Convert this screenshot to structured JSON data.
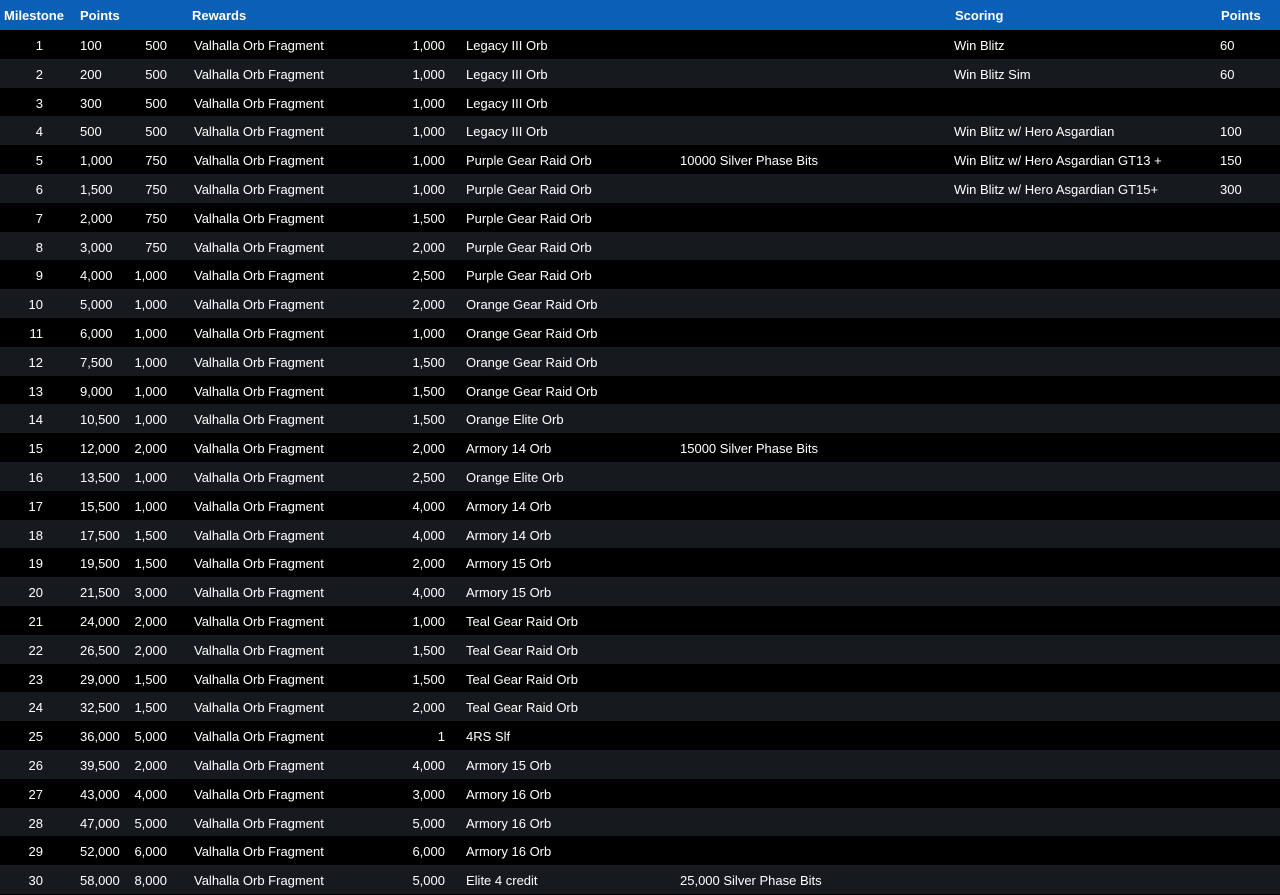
{
  "headers": {
    "milestone": "Milestone",
    "points": "Points",
    "rewards": "Rewards",
    "scoring": "Scoring",
    "scoring_points": "Points"
  },
  "rows": [
    {
      "milestone": "1",
      "points": "100",
      "r1_qty": "500",
      "r1_name": "Valhalla Orb Fragment",
      "r2_qty": "1,000",
      "r2_name": "Legacy III Orb",
      "r3": "",
      "scoring": "Win Blitz",
      "scoring_points": "60"
    },
    {
      "milestone": "2",
      "points": "200",
      "r1_qty": "500",
      "r1_name": "Valhalla Orb Fragment",
      "r2_qty": "1,000",
      "r2_name": "Legacy III Orb",
      "r3": "",
      "scoring": "Win Blitz Sim",
      "scoring_points": "60"
    },
    {
      "milestone": "3",
      "points": "300",
      "r1_qty": "500",
      "r1_name": "Valhalla Orb Fragment",
      "r2_qty": "1,000",
      "r2_name": "Legacy III Orb",
      "r3": "",
      "scoring": "",
      "scoring_points": ""
    },
    {
      "milestone": "4",
      "points": "500",
      "r1_qty": "500",
      "r1_name": "Valhalla Orb Fragment",
      "r2_qty": "1,000",
      "r2_name": "Legacy III Orb",
      "r3": "",
      "scoring": "Win Blitz w/ Hero Asgardian",
      "scoring_points": "100"
    },
    {
      "milestone": "5",
      "points": "1,000",
      "r1_qty": "750",
      "r1_name": "Valhalla Orb Fragment",
      "r2_qty": "1,000",
      "r2_name": "Purple Gear Raid Orb",
      "r3": "10000  Silver Phase Bits",
      "scoring": "Win Blitz w/ Hero Asgardian GT13 +",
      "scoring_points": "150"
    },
    {
      "milestone": "6",
      "points": "1,500",
      "r1_qty": "750",
      "r1_name": "Valhalla Orb Fragment",
      "r2_qty": "1,000",
      "r2_name": "Purple Gear Raid Orb",
      "r3": "",
      "scoring": "Win Blitz w/ Hero Asgardian GT15+",
      "scoring_points": "300"
    },
    {
      "milestone": "7",
      "points": "2,000",
      "r1_qty": "750",
      "r1_name": "Valhalla Orb Fragment",
      "r2_qty": "1,500",
      "r2_name": "Purple Gear Raid Orb",
      "r3": "",
      "scoring": "",
      "scoring_points": ""
    },
    {
      "milestone": "8",
      "points": "3,000",
      "r1_qty": "750",
      "r1_name": "Valhalla Orb Fragment",
      "r2_qty": "2,000",
      "r2_name": "Purple Gear Raid Orb",
      "r3": "",
      "scoring": "",
      "scoring_points": ""
    },
    {
      "milestone": "9",
      "points": "4,000",
      "r1_qty": "1,000",
      "r1_name": "Valhalla Orb Fragment",
      "r2_qty": "2,500",
      "r2_name": "Purple Gear Raid Orb",
      "r3": "",
      "scoring": "",
      "scoring_points": ""
    },
    {
      "milestone": "10",
      "points": "5,000",
      "r1_qty": "1,000",
      "r1_name": "Valhalla Orb Fragment",
      "r2_qty": "2,000",
      "r2_name": "Orange Gear Raid Orb",
      "r3": "",
      "scoring": "",
      "scoring_points": ""
    },
    {
      "milestone": "11",
      "points": "6,000",
      "r1_qty": "1,000",
      "r1_name": "Valhalla Orb Fragment",
      "r2_qty": "1,000",
      "r2_name": "Orange Gear Raid Orb",
      "r3": "",
      "scoring": "",
      "scoring_points": ""
    },
    {
      "milestone": "12",
      "points": "7,500",
      "r1_qty": "1,000",
      "r1_name": "Valhalla Orb Fragment",
      "r2_qty": "1,500",
      "r2_name": "Orange Gear Raid Orb",
      "r3": "",
      "scoring": "",
      "scoring_points": ""
    },
    {
      "milestone": "13",
      "points": "9,000",
      "r1_qty": "1,000",
      "r1_name": "Valhalla Orb Fragment",
      "r2_qty": "1,500",
      "r2_name": "Orange Gear Raid Orb",
      "r3": "",
      "scoring": "",
      "scoring_points": ""
    },
    {
      "milestone": "14",
      "points": "10,500",
      "r1_qty": "1,000",
      "r1_name": "Valhalla Orb Fragment",
      "r2_qty": "1,500",
      "r2_name": "Orange Elite Orb",
      "r3": "",
      "scoring": "",
      "scoring_points": ""
    },
    {
      "milestone": "15",
      "points": "12,000",
      "r1_qty": "2,000",
      "r1_name": "Valhalla Orb Fragment",
      "r2_qty": "2,000",
      "r2_name": "Armory 14 Orb",
      "r3": "15000  Silver Phase Bits",
      "scoring": "",
      "scoring_points": ""
    },
    {
      "milestone": "16",
      "points": "13,500",
      "r1_qty": "1,000",
      "r1_name": "Valhalla Orb Fragment",
      "r2_qty": "2,500",
      "r2_name": "Orange Elite Orb",
      "r3": "",
      "scoring": "",
      "scoring_points": ""
    },
    {
      "milestone": "17",
      "points": "15,500",
      "r1_qty": "1,000",
      "r1_name": "Valhalla Orb Fragment",
      "r2_qty": "4,000",
      "r2_name": "Armory 14 Orb",
      "r3": "",
      "scoring": "",
      "scoring_points": ""
    },
    {
      "milestone": "18",
      "points": "17,500",
      "r1_qty": "1,500",
      "r1_name": "Valhalla Orb Fragment",
      "r2_qty": "4,000",
      "r2_name": "Armory 14 Orb",
      "r3": "",
      "scoring": "",
      "scoring_points": ""
    },
    {
      "milestone": "19",
      "points": "19,500",
      "r1_qty": "1,500",
      "r1_name": "Valhalla Orb Fragment",
      "r2_qty": "2,000",
      "r2_name": "Armory 15 Orb",
      "r3": "",
      "scoring": "",
      "scoring_points": ""
    },
    {
      "milestone": "20",
      "points": "21,500",
      "r1_qty": "3,000",
      "r1_name": "Valhalla Orb Fragment",
      "r2_qty": "4,000",
      "r2_name": "Armory 15 Orb",
      "r3": "",
      "scoring": "",
      "scoring_points": ""
    },
    {
      "milestone": "21",
      "points": "24,000",
      "r1_qty": "2,000",
      "r1_name": "Valhalla Orb Fragment",
      "r2_qty": "1,000",
      "r2_name": "Teal Gear Raid Orb",
      "r3": "",
      "scoring": "",
      "scoring_points": ""
    },
    {
      "milestone": "22",
      "points": "26,500",
      "r1_qty": "2,000",
      "r1_name": "Valhalla Orb Fragment",
      "r2_qty": "1,500",
      "r2_name": "Teal Gear Raid Orb",
      "r3": "",
      "scoring": "",
      "scoring_points": ""
    },
    {
      "milestone": "23",
      "points": "29,000",
      "r1_qty": "1,500",
      "r1_name": "Valhalla Orb Fragment",
      "r2_qty": "1,500",
      "r2_name": "Teal Gear Raid Orb",
      "r3": "",
      "scoring": "",
      "scoring_points": ""
    },
    {
      "milestone": "24",
      "points": "32,500",
      "r1_qty": "1,500",
      "r1_name": "Valhalla Orb Fragment",
      "r2_qty": "2,000",
      "r2_name": "Teal Gear Raid Orb",
      "r3": "",
      "scoring": "",
      "scoring_points": ""
    },
    {
      "milestone": "25",
      "points": "36,000",
      "r1_qty": "5,000",
      "r1_name": "Valhalla Orb Fragment",
      "r2_qty": "1",
      "r2_name": "4RS Slf",
      "r3": "",
      "scoring": "",
      "scoring_points": ""
    },
    {
      "milestone": "26",
      "points": "39,500",
      "r1_qty": "2,000",
      "r1_name": "Valhalla Orb Fragment",
      "r2_qty": "4,000",
      "r2_name": "Armory 15 Orb",
      "r3": "",
      "scoring": "",
      "scoring_points": ""
    },
    {
      "milestone": "27",
      "points": "43,000",
      "r1_qty": "4,000",
      "r1_name": "Valhalla Orb Fragment",
      "r2_qty": "3,000",
      "r2_name": "Armory 16 Orb",
      "r3": "",
      "scoring": "",
      "scoring_points": ""
    },
    {
      "milestone": "28",
      "points": "47,000",
      "r1_qty": "5,000",
      "r1_name": "Valhalla Orb Fragment",
      "r2_qty": "5,000",
      "r2_name": "Armory 16 Orb",
      "r3": "",
      "scoring": "",
      "scoring_points": ""
    },
    {
      "milestone": "29",
      "points": "52,000",
      "r1_qty": "6,000",
      "r1_name": "Valhalla Orb Fragment",
      "r2_qty": "6,000",
      "r2_name": "Armory 16 Orb",
      "r3": "",
      "scoring": "",
      "scoring_points": ""
    },
    {
      "milestone": "30",
      "points": "58,000",
      "r1_qty": "8,000",
      "r1_name": "Valhalla Orb Fragment",
      "r2_qty": "5,000",
      "r2_name": "Elite 4 credit",
      "r3": "25,000 Silver Phase Bits",
      "scoring": "",
      "scoring_points": ""
    }
  ]
}
